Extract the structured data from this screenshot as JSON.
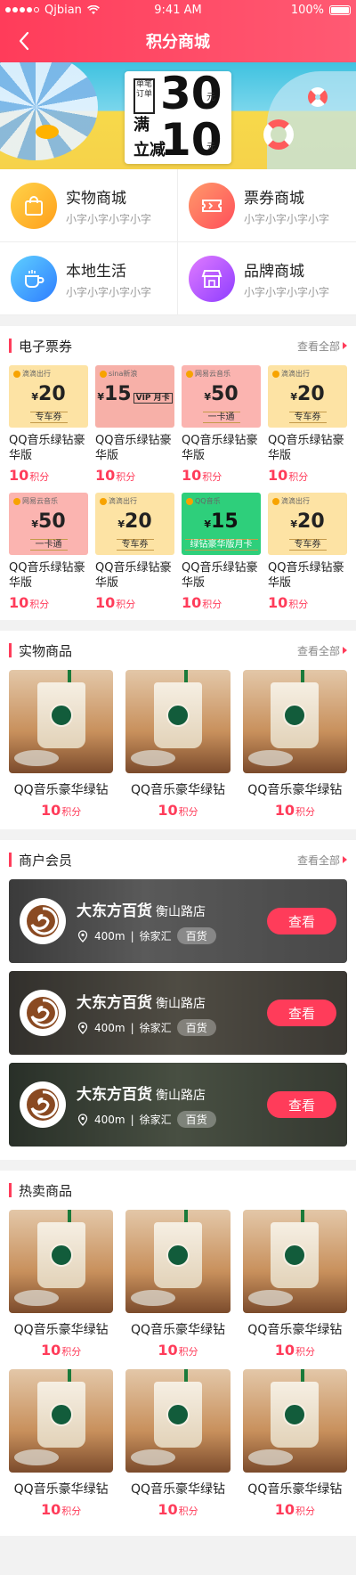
{
  "status_bar": {
    "carrier": "Qjbian",
    "time": "9:41 AM",
    "battery": "100%"
  },
  "nav": {
    "title": "积分商城"
  },
  "banner": {
    "tag": "单笔订单",
    "line1": "满",
    "amount1": "30",
    "line2": "立减",
    "amount2": "10",
    "unit": "元"
  },
  "categories": [
    {
      "name": "实物商城",
      "sub": "小字小字小字小字",
      "icon": "shopping-bag-icon",
      "color": "#ffb21a"
    },
    {
      "name": "票券商城",
      "sub": "小字小字小字小字",
      "icon": "ticket-icon",
      "color": "#ff6b57"
    },
    {
      "name": "本地生活",
      "sub": "小字小字小字小字",
      "icon": "coffee-cup-icon",
      "color": "#3aa8ff"
    },
    {
      "name": "品牌商城",
      "sub": "小字小字小字小字",
      "icon": "store-icon",
      "color": "#b04bff"
    }
  ],
  "etickets": {
    "title": "电子票券",
    "more": "查看全部",
    "items": [
      {
        "brand": "滴滴出行",
        "cur": "¥",
        "value": "20",
        "badge": "",
        "desc": "专车券",
        "name": "QQ音乐绿钻豪华版",
        "points": "10",
        "unit": "积分",
        "style": "t-yellow"
      },
      {
        "brand": "sina新浪",
        "cur": "¥",
        "value": "15",
        "badge": "VIP 月卡",
        "desc": "",
        "name": "QQ音乐绿钻豪华版",
        "points": "10",
        "unit": "积分",
        "style": "t-red"
      },
      {
        "brand": "网易云音乐",
        "cur": "¥",
        "value": "50",
        "badge": "",
        "desc": "一卡通",
        "name": "QQ音乐绿钻豪华版",
        "points": "10",
        "unit": "积分",
        "style": "t-pink"
      },
      {
        "brand": "滴滴出行",
        "cur": "¥",
        "value": "20",
        "badge": "",
        "desc": "专车券",
        "name": "QQ音乐绿钻豪华版",
        "points": "10",
        "unit": "积分",
        "style": "t-yellow"
      },
      {
        "brand": "网易云音乐",
        "cur": "¥",
        "value": "50",
        "badge": "",
        "desc": "一卡通",
        "name": "QQ音乐绿钻豪华版",
        "points": "10",
        "unit": "积分",
        "style": "t-pink"
      },
      {
        "brand": "滴滴出行",
        "cur": "¥",
        "value": "20",
        "badge": "",
        "desc": "专车券",
        "name": "QQ音乐绿钻豪华版",
        "points": "10",
        "unit": "积分",
        "style": "t-yellow"
      },
      {
        "brand": "QQ音乐",
        "cur": "¥",
        "value": "15",
        "badge": "",
        "desc": "绿钻豪华版月卡",
        "name": "QQ音乐绿钻豪华版",
        "points": "10",
        "unit": "积分",
        "style": "t-green"
      },
      {
        "brand": "滴滴出行",
        "cur": "¥",
        "value": "20",
        "badge": "",
        "desc": "专车券",
        "name": "QQ音乐绿钻豪华版",
        "points": "10",
        "unit": "积分",
        "style": "t-yellow"
      }
    ]
  },
  "physical": {
    "title": "实物商品",
    "more": "查看全部",
    "items": [
      {
        "name": "QQ音乐豪华绿钻",
        "points": "10",
        "unit": "积分"
      },
      {
        "name": "QQ音乐豪华绿钻",
        "points": "10",
        "unit": "积分"
      },
      {
        "name": "QQ音乐豪华绿钻",
        "points": "10",
        "unit": "积分"
      }
    ]
  },
  "merchants": {
    "title": "商户会员",
    "more": "查看全部",
    "items": [
      {
        "name": "大东方百货",
        "branch": "衡山路店",
        "distance": "400m",
        "area": "徐家汇",
        "category": "百货",
        "button": "查看"
      },
      {
        "name": "大东方百货",
        "branch": "衡山路店",
        "distance": "400m",
        "area": "徐家汇",
        "category": "百货",
        "button": "查看"
      },
      {
        "name": "大东方百货",
        "branch": "衡山路店",
        "distance": "400m",
        "area": "徐家汇",
        "category": "百货",
        "button": "查看"
      }
    ]
  },
  "hot": {
    "title": "热卖商品",
    "items": [
      {
        "name": "QQ音乐豪华绿钻",
        "points": "10",
        "unit": "积分"
      },
      {
        "name": "QQ音乐豪华绿钻",
        "points": "10",
        "unit": "积分"
      },
      {
        "name": "QQ音乐豪华绿钻",
        "points": "10",
        "unit": "积分"
      },
      {
        "name": "QQ音乐豪华绿钻",
        "points": "10",
        "unit": "积分"
      },
      {
        "name": "QQ音乐豪华绿钻",
        "points": "10",
        "unit": "积分"
      },
      {
        "name": "QQ音乐豪华绿钻",
        "points": "10",
        "unit": "积分"
      }
    ]
  },
  "colors": {
    "accent": "#ff3c5a",
    "background": "#f2f2f2"
  }
}
